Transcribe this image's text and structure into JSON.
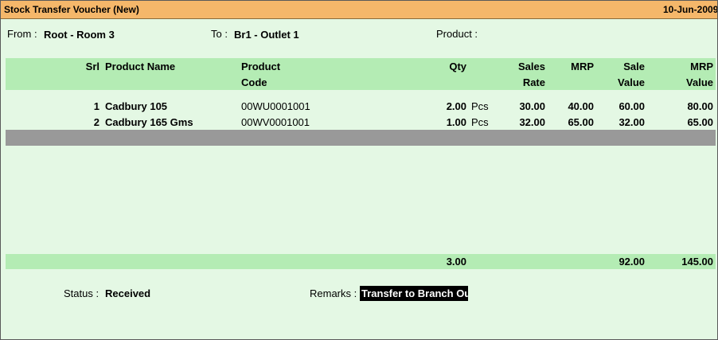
{
  "window": {
    "title": "Stock Transfer Voucher (New)",
    "date": "10-Jun-2009"
  },
  "fields": {
    "from_label": "From :",
    "from_value": "Root - Room 3",
    "to_label": "To :",
    "to_value": "Br1 - Outlet 1",
    "product_label": "Product :",
    "product_value": ""
  },
  "columns": {
    "srl": "Srl",
    "product_name": "Product Name",
    "product_code_1": "Product",
    "product_code_2": "Code",
    "qty": "Qty",
    "sales_rate_1": "Sales",
    "sales_rate_2": "Rate",
    "mrp": "MRP",
    "sale_value_1": "Sale",
    "sale_value_2": "Value",
    "mrp_value_1": "MRP",
    "mrp_value_2": "Value"
  },
  "rows": [
    {
      "srl": "1",
      "product_name": "Cadbury 105",
      "product_code": "00WU0001001",
      "qty": "2.00",
      "unit": "Pcs",
      "sales_rate": "30.00",
      "mrp": "40.00",
      "sale_value": "60.00",
      "mrp_value": "80.00"
    },
    {
      "srl": "2",
      "product_name": "Cadbury 165 Gms",
      "product_code": "00WV0001001",
      "qty": "1.00",
      "unit": "Pcs",
      "sales_rate": "32.00",
      "mrp": "65.00",
      "sale_value": "32.00",
      "mrp_value": "65.00"
    }
  ],
  "totals": {
    "qty": "3.00",
    "sale_value": "92.00",
    "mrp_value": "145.00"
  },
  "footer": {
    "status_label": "Status :",
    "status_value": "Received",
    "remarks_label": "Remarks :",
    "remarks_value": "Transfer to Branch Outlet"
  },
  "colors": {
    "background": "#e4f8e4",
    "title_bar": "#f5b76a",
    "header_band": "#b4ecb4",
    "selected_row": "#999999"
  }
}
